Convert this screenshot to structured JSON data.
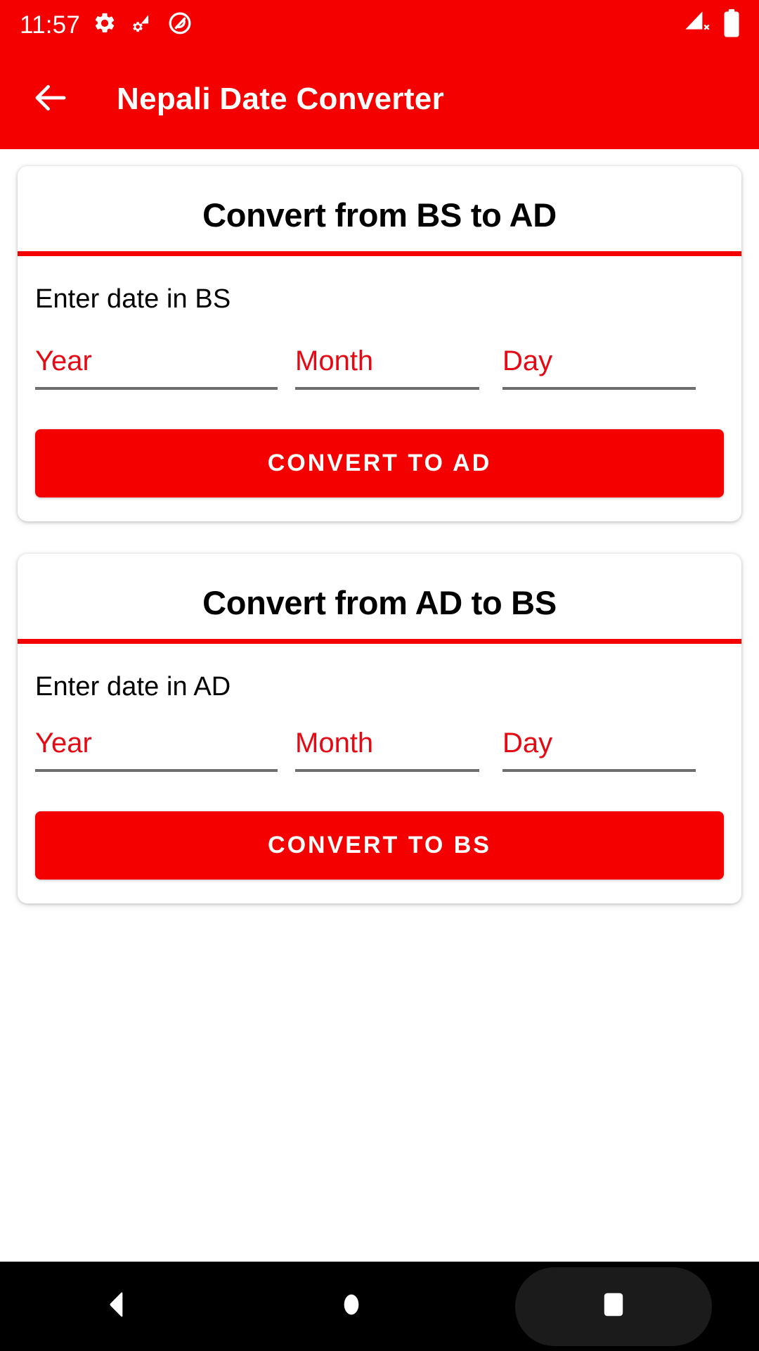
{
  "theme": {
    "brand_color": "#f40000",
    "accent_red": "#e50914",
    "underline_gray": "#6e6e6e"
  },
  "status_bar": {
    "clock": "11:57",
    "left_icons": [
      "gear-icon",
      "gear-wifi-icon",
      "dnd-circle-slash-icon"
    ],
    "right_icons": [
      "signal-no-service-icon",
      "battery-full-icon"
    ]
  },
  "app_bar": {
    "back_icon": "arrow-left-icon",
    "title": "Nepali Date Converter"
  },
  "cards": [
    {
      "title": "Convert from BS to AD",
      "subtitle": "Enter date in BS",
      "fields": [
        {
          "name": "year",
          "placeholder": "Year",
          "value": ""
        },
        {
          "name": "month",
          "placeholder": "Month",
          "value": ""
        },
        {
          "name": "day",
          "placeholder": "Day",
          "value": ""
        }
      ],
      "button_label": "CONVERT TO AD"
    },
    {
      "title": "Convert from AD to BS",
      "subtitle": "Enter date in AD",
      "fields": [
        {
          "name": "year",
          "placeholder": "Year",
          "value": ""
        },
        {
          "name": "month",
          "placeholder": "Month",
          "value": ""
        },
        {
          "name": "day",
          "placeholder": "Day",
          "value": ""
        }
      ],
      "button_label": "CONVERT TO BS"
    }
  ],
  "nav_bar": {
    "back_icon": "triangle-back-icon",
    "home_icon": "circle-home-icon",
    "recents_icon": "square-recents-icon"
  }
}
